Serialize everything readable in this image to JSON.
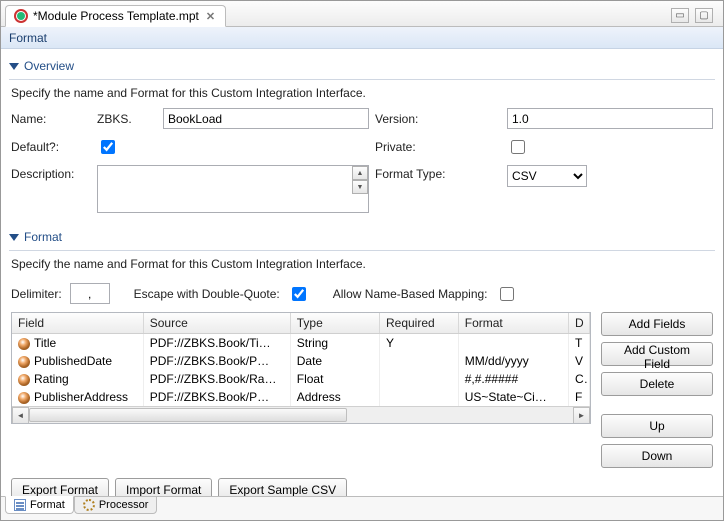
{
  "top_tab": {
    "title": "*Module Process Template.mpt"
  },
  "header": {
    "title": "Format"
  },
  "overview": {
    "section_title": "Overview",
    "description_text": "Specify the name and Format for this Custom Integration Interface.",
    "labels": {
      "name": "Name:",
      "default": "Default?:",
      "description": "Description:",
      "version": "Version:",
      "private": "Private:",
      "format_type": "Format Type:"
    },
    "name_prefix": "ZBKS.",
    "name_value": "BookLoad",
    "default_checked": true,
    "description_value": "",
    "version_value": "1.0",
    "private_checked": false,
    "format_type_value": "CSV"
  },
  "format": {
    "section_title": "Format",
    "description_text": "Specify the name and Format for this Custom Integration Interface.",
    "labels": {
      "delimiter": "Delimiter:",
      "escape": "Escape with Double-Quote:",
      "allow_name": "Allow Name-Based Mapping:"
    },
    "delimiter_value": ",",
    "escape_checked": true,
    "allow_name_checked": false,
    "table": {
      "headers": {
        "field": "Field",
        "source": "Source",
        "type": "Type",
        "required": "Required",
        "format": "Format",
        "extra": "D"
      },
      "rows": [
        {
          "field": "Title",
          "source": "PDF://ZBKS.Book/Ti…",
          "type": "String",
          "required": "Y",
          "format": "",
          "extra": "T"
        },
        {
          "field": "PublishedDate",
          "source": "PDF://ZBKS.Book/P…",
          "type": "Date",
          "required": "",
          "format": "MM/dd/yyyy",
          "extra": "V"
        },
        {
          "field": "Rating",
          "source": "PDF://ZBKS.Book/Ra…",
          "type": "Float",
          "required": "",
          "format": "#,#.#####",
          "extra": "C"
        },
        {
          "field": "PublisherAddress",
          "source": "PDF://ZBKS.Book/P…",
          "type": "Address",
          "required": "",
          "format": "US~State~Ci…",
          "extra": "F"
        }
      ]
    },
    "side_buttons": {
      "add_fields": "Add Fields",
      "add_custom": "Add Custom Field",
      "delete": "Delete",
      "up": "Up",
      "down": "Down"
    },
    "export_buttons": {
      "export_format": "Export Format",
      "import_format": "Import Format",
      "export_sample": "Export Sample CSV"
    }
  },
  "bottom_tabs": {
    "format": "Format",
    "processor": "Processor"
  }
}
